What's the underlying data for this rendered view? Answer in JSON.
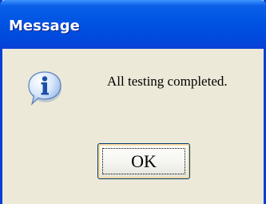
{
  "window": {
    "title": "Message",
    "titlebar_color": "#0054e3",
    "frame_color": "#ece9d8"
  },
  "dialog": {
    "icon": "information-icon",
    "message": "All testing completed.",
    "ok_label": "OK"
  }
}
